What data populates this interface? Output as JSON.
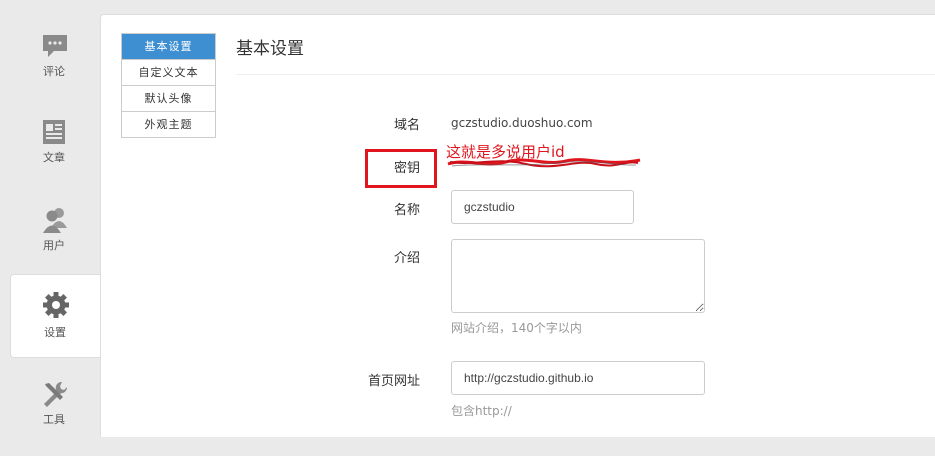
{
  "nav": {
    "items": [
      {
        "label": "评论",
        "icon": "comment-icon"
      },
      {
        "label": "文章",
        "icon": "article-icon"
      },
      {
        "label": "用户",
        "icon": "users-icon"
      },
      {
        "label": "设置",
        "icon": "gear-icon",
        "active": true
      },
      {
        "label": "工具",
        "icon": "tools-icon"
      }
    ]
  },
  "submenu": {
    "items": [
      {
        "label": "基本设置",
        "active": true
      },
      {
        "label": "自定义文本"
      },
      {
        "label": "默认头像"
      },
      {
        "label": "外观主题"
      }
    ]
  },
  "page": {
    "title": "基本设置"
  },
  "form": {
    "domain": {
      "label": "域名",
      "value": "gczstudio.duoshuo.com"
    },
    "key": {
      "label": "密钥",
      "annotation": "这就是多说用户id"
    },
    "name": {
      "label": "名称",
      "value": "gczstudio"
    },
    "intro": {
      "label": "介绍",
      "value": "",
      "hint": "网站介绍，140个字以内"
    },
    "homepage": {
      "label": "首页网址",
      "value": "http://gczstudio.github.io",
      "hint": "包含http://"
    }
  },
  "colors": {
    "accent": "#3d8fd1",
    "annotation_red": "#e0151d",
    "icon_gray": "#8a8a8a"
  }
}
